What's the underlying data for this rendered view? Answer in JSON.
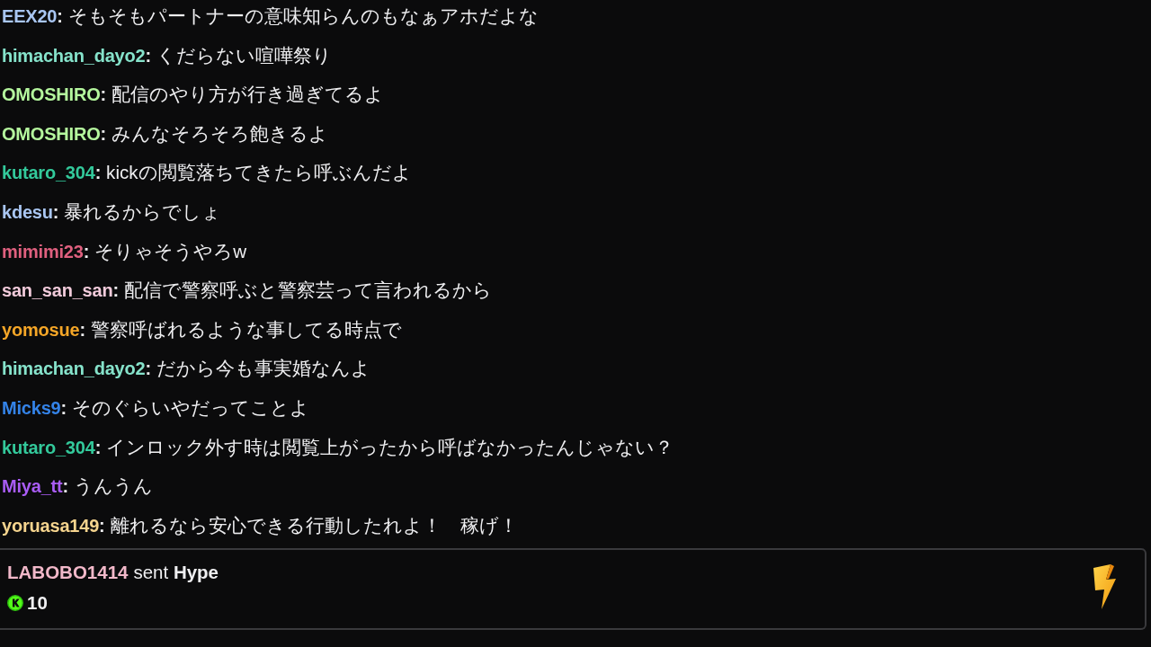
{
  "chat": {
    "messages": [
      {
        "username": "EEX20",
        "separator": ":",
        "color": "#a9c6f2",
        "text": "そもそもパートナーの意味知らんのもなぁアホだよな"
      },
      {
        "username": "himachan_dayo2",
        "separator": ":",
        "color": "#86e3cb",
        "text": "くだらない喧嘩祭り"
      },
      {
        "username": "OMOSHIRO",
        "separator": ":",
        "color": "#b5f79e",
        "text": "配信のやり方が行き過ぎてるよ"
      },
      {
        "username": "OMOSHIRO",
        "separator": ":",
        "color": "#b5f79e",
        "text": "みんなそろそろ飽きるよ"
      },
      {
        "username": "kutaro_304",
        "separator": ":",
        "color": "#33c99b",
        "text": "kickの閲覧落ちてきたら呼ぶんだよ"
      },
      {
        "username": "kdesu",
        "separator": ":",
        "color": "#a9c6f2",
        "text": "暴れるからでしょ"
      },
      {
        "username": "mimimi23",
        "separator": ":",
        "color": "#e0607f",
        "text": "そりゃそうやろw"
      },
      {
        "username": "san_san_san",
        "separator": ":",
        "color": "#f2cbdb",
        "text": "配信で警察呼ぶと警察芸って言われるから"
      },
      {
        "username": "yomosue",
        "separator": ":",
        "color": "#f5a627",
        "text": "警察呼ばれるような事してる時点で"
      },
      {
        "username": "himachan_dayo2",
        "separator": ":",
        "color": "#86e3cb",
        "text": "だから今も事実婚なんよ"
      },
      {
        "username": "Micks9",
        "separator": ":",
        "color": "#3483e8",
        "text": "そのぐらいやだってことよ"
      },
      {
        "username": "kutaro_304",
        "separator": ":",
        "color": "#33c99b",
        "text": "インロック外す時は閲覧上がったから呼ばなかったんじゃない？"
      },
      {
        "username": "Miya_tt",
        "separator": ":",
        "color": "#a95cf5",
        "text": "うんうん"
      },
      {
        "username": "yoruasa149",
        "separator": ":",
        "color": "#f5d48e",
        "text": "離れるなら安心できる行動したれよ！　稼げ！"
      }
    ]
  },
  "hype_event": {
    "sender": "LABOBO1414",
    "message": "sent **Hype**",
    "amount": "10"
  }
}
